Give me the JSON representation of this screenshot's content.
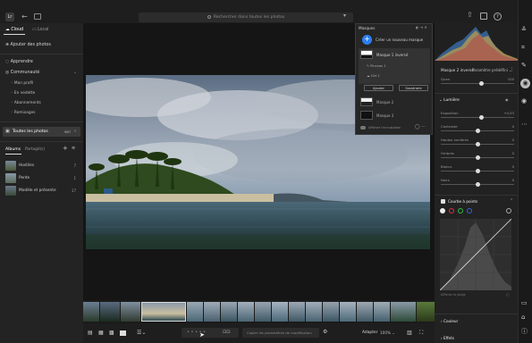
{
  "search": {
    "placeholder": "Rechercher dans toutes les photos"
  },
  "sidebar": {
    "tab_cloud": "Cloud",
    "tab_local": "Local",
    "add_photos": "Ajouter des photos",
    "learn": "Apprendre",
    "community": "Communauté",
    "community_items": [
      "Mon profil",
      "En vedette",
      "Abonnements",
      "Remixages"
    ],
    "all_photos": "Toutes les photos",
    "all_photos_badge": "987",
    "albums_tab": "Albums",
    "shared_tab": "Partagé(s)",
    "albums": [
      {
        "label": "Hostiles",
        "count": "7"
      },
      {
        "label": "Pente",
        "count": "1"
      },
      {
        "label": "Modèle et présente",
        "count": "17"
      }
    ]
  },
  "masks": {
    "title": "Masques",
    "create_new": "Créer un nouveau masque",
    "mask1": "Masque 1 inversé",
    "sub1": "Pinceau 1",
    "sub2": "Ciel 1",
    "add_button": "Ajouter",
    "subtract_button": "Soustraire",
    "mask2": "Masque 2",
    "mask3": "Masque 3",
    "overlay_label": "Afficher l'incrustation"
  },
  "right": {
    "mask_name": "Masque 2 inversé",
    "preset": "Paramètre prédéfini",
    "amount_label": "Quan",
    "amount_value": "100",
    "section_light": "Lumière",
    "light_sliders": [
      {
        "label": "Exposition",
        "value": "+0,53"
      },
      {
        "label": "Contraste",
        "value": "0"
      },
      {
        "label": "Hautes lumières",
        "value": "0"
      },
      {
        "label": "Ombres",
        "value": "0"
      },
      {
        "label": "Blancs",
        "value": "0"
      },
      {
        "label": "Noirs",
        "value": "0"
      }
    ],
    "section_curve": "Courbe à points",
    "curve_footer": "Afficher la plage",
    "section_color": "Couleur",
    "section_effects": "Effets"
  },
  "bottom": {
    "copy_field_placeholder": "Copier les paramètres de modification",
    "fit_label": "Adapter",
    "zoom_value": "100%"
  }
}
